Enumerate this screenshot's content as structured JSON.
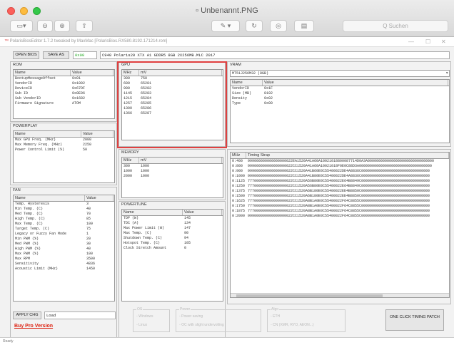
{
  "window": {
    "title": "Unbenannt.PNG",
    "search_placeholder": "Q Suchen"
  },
  "app": {
    "title_prefix": "™",
    "title": "PolarisBiosEditor 1.7.2 tweaked by MaxMac",
    "subtitle": "[PolarisBios.RX580.8192.171214.rom]",
    "open_bios": "OPEN BIOS",
    "save_as": "SAVE AS",
    "checksum": "0x00",
    "device_name": "C940 Polaris20 XTX A1 GDDR5 8GB 2X256MB.MLC 2017",
    "apply_changes": "APPLY CHG",
    "apply_field": "Load",
    "buy_pro": "Buy Pro Version",
    "one_click": "ONE CLICK TIMING PATCH",
    "status": "Ready"
  },
  "rom": {
    "title": "ROM",
    "headers": [
      "Name",
      "Value"
    ],
    "rows": [
      [
        "BootupMessageOffset",
        "0x01"
      ],
      [
        "VendorID",
        "0x1002"
      ],
      [
        "DeviceID",
        "0x67DF"
      ],
      [
        "Sub ID",
        "0x0E96"
      ],
      [
        "Sub VendorID",
        "0x1682"
      ],
      [
        "Firmware Signature",
        "ATOM"
      ]
    ]
  },
  "powerplay": {
    "title": "POWERPLAY",
    "headers": [
      "Name",
      "Value"
    ],
    "rows": [
      [
        "Max GPU Freq. (MHz)",
        "2000"
      ],
      [
        "Max Memory Freq. (MHz)",
        "2250"
      ],
      [
        "Power Control Limit (%)",
        "50"
      ]
    ]
  },
  "fan": {
    "title": "FAN",
    "headers": [
      "Name",
      "Value"
    ],
    "rows": [
      [
        "Temp. Hysteresis",
        "3"
      ],
      [
        "Min Temp. (C)",
        "40"
      ],
      [
        "Med Temp. (C)",
        "70"
      ],
      [
        "High Temp. (C)",
        "85"
      ],
      [
        "Max Temp. (C)",
        "109"
      ],
      [
        "Target Temp. (C)",
        "75"
      ],
      [
        "Legacy or Fuzzy Fan Mode",
        "1"
      ],
      [
        "Min PWM (%)",
        "20"
      ],
      [
        "Med PWM (%)",
        "30"
      ],
      [
        "High PWM (%)",
        "40"
      ],
      [
        "Max PWM (%)",
        "100"
      ],
      [
        "Max RPM",
        "3500"
      ],
      [
        "Sensitivity",
        "4836"
      ],
      [
        "Acoustic Limit (MHz)",
        "1450"
      ]
    ]
  },
  "gpu": {
    "title": "GPU",
    "headers": [
      "MHz",
      "mV"
    ],
    "rows": [
      [
        "300",
        "750"
      ],
      [
        "600",
        "65281"
      ],
      [
        "900",
        "65282"
      ],
      [
        "1145",
        "65283"
      ],
      [
        "1215",
        "65284"
      ],
      [
        "1257",
        "65285"
      ],
      [
        "1300",
        "65286"
      ],
      [
        "1366",
        "65287"
      ]
    ]
  },
  "memory": {
    "title": "MEMORY",
    "headers": [
      "MHz",
      "mV"
    ],
    "rows": [
      [
        "300",
        "1000"
      ],
      [
        "1000",
        "1000"
      ],
      [
        "2000",
        "1000"
      ]
    ]
  },
  "powertune": {
    "title": "POWERTUNE",
    "headers": [
      "Name",
      "Value"
    ],
    "rows": [
      [
        "TDP (W)",
        "145"
      ],
      [
        "TDC (A)",
        "134"
      ],
      [
        "Max Power Limit (W)",
        "147"
      ],
      [
        "Max Temp. (C)",
        "90"
      ],
      [
        "Shutdown Temp. (C)",
        "94"
      ],
      [
        "Hotspot Temp. (C)",
        "105"
      ],
      [
        "Clock Stretch Amount",
        "0"
      ]
    ]
  },
  "vram": {
    "title": "VRAM",
    "selected": "MT51J256M32 (8GB)",
    "headers": [
      "Name",
      "Value"
    ],
    "rows": [
      [
        "VendorID",
        "0x1F"
      ],
      [
        "Size (MB)",
        "8192"
      ],
      [
        "Density",
        "0x02"
      ],
      [
        "Type",
        "0x00"
      ]
    ]
  },
  "timings": {
    "headers": [
      "MHz",
      "Timing Strap"
    ],
    "rows": [
      [
        "0:400",
        "999000000000000000022EA1520A41A60A10021018800087714D0A3A0000000000000000000000000000000"
      ],
      [
        "0:800",
        "999000000000000000022CC1520A41A60A10021018F0E0C88D3A0000000000000000000000000000000000"
      ],
      [
        "0:900",
        "999000000000000000022CC1520A41B60E0C55400022DE4A8836C00000000000000000000000000000000"
      ],
      [
        "0:1000",
        "999000000000000000022CC1520A41B80E0C55400022DE4A8836C00000000000000000000000000000000"
      ],
      [
        "0:1125",
        "777000000000000000022CC1520A56B80E0C55400022E64B8849C00000000000000000000000000000000"
      ],
      [
        "0:1250",
        "777000000000000000022CC1520A56B80E0C55400022E64B8849C00000000000000000000000000000000"
      ],
      [
        "0:1375",
        "777000000000000000022CC1520A6B180E0C55400022EE4B8850C00000000000000000000000000000000"
      ],
      [
        "0:1500",
        "777000000000000000022CC1520A6B180E0C55400022EE4B8850C00000000000000000000000000000000"
      ],
      [
        "0:1625",
        "777000000000000000022CC1520A8B1A0E0C55400022F64C8855C00000000000000000000000000000000"
      ],
      [
        "0:1750",
        "777000000000000000022CC1520A8B1A0E0C55400022F64C8855C00000000000000000000000000000000"
      ],
      [
        "0:1875",
        "777000000000000000022CC1520A8B1A0E0C55400022F64C8855C00000000000000000000000000000000"
      ],
      [
        "0:2000",
        "999000000000000000022CC1520A8B1A0E0C55400022F64C8855C00000000000000000000000000000000"
      ]
    ]
  },
  "groups": {
    "os": {
      "title": "OS",
      "options": [
        "Windows",
        "Linux"
      ]
    },
    "power": {
      "title": "Power",
      "options": [
        "Power saving",
        "OC with slight undervolting"
      ]
    },
    "algo": {
      "title": "Algo",
      "options": [
        "ETH",
        "CN (XMR, RYO, AEON...)"
      ]
    }
  }
}
